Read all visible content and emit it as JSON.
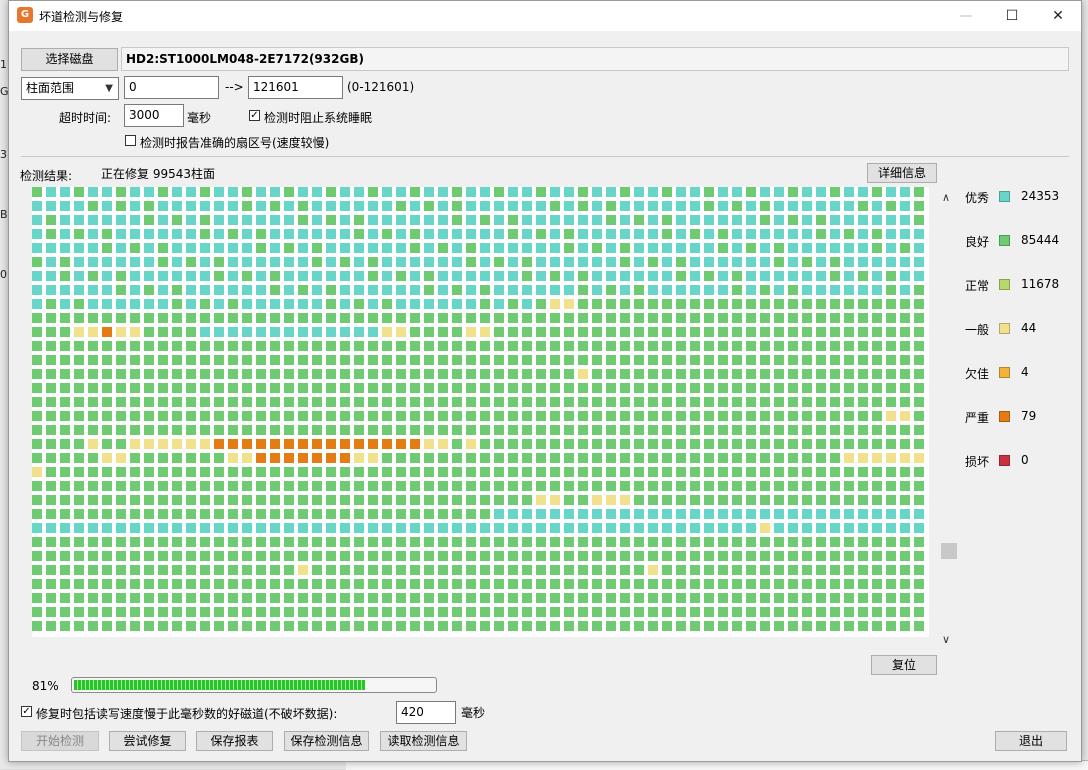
{
  "window": {
    "title": "坏道检测与修复",
    "icon": "app-logo-icon"
  },
  "disk": {
    "select_button": "选择磁盘",
    "name": "HD2:ST1000LM048-2E7172(932GB)"
  },
  "range": {
    "mode": "柱面范围",
    "start": "0",
    "arrow": "-->",
    "end": "121601",
    "hint": "(0-121601)"
  },
  "timeout": {
    "label": "超时时间:",
    "value": "3000",
    "unit": "毫秒"
  },
  "options": {
    "prevent_sleep_label": "检测时阻止系统睡眠",
    "prevent_sleep": true,
    "report_sector_label": "检测时报告准确的扇区号(速度较慢)",
    "report_sector": false
  },
  "result": {
    "label": "检测结果:",
    "status": "正在修复 99543柱面",
    "detail_button": "详细信息"
  },
  "legend": [
    {
      "name": "优秀",
      "count": "24353",
      "color": "#67d6c8"
    },
    {
      "name": "良好",
      "count": "85444",
      "color": "#6ecb72"
    },
    {
      "name": "正常",
      "count": "11678",
      "color": "#b7d86a"
    },
    {
      "name": "一般",
      "count": "44",
      "color": "#f1e18c"
    },
    {
      "name": "欠佳",
      "count": "4",
      "color": "#f2b33d"
    },
    {
      "name": "严重",
      "count": "79",
      "color": "#e57b13"
    },
    {
      "name": "损坏",
      "count": "0",
      "color": "#c8323c"
    }
  ],
  "reset_button": "复位",
  "progress": {
    "percent_label": "81%",
    "value": 0.81
  },
  "repair_option": {
    "checked": true,
    "label": "修复时包括读写速度慢于此毫秒数的好磁道(不破坏数据):",
    "value": "420",
    "unit": "毫秒"
  },
  "buttons": {
    "start": "开始检测",
    "try_repair": "尝试修复",
    "save_report": "保存报表",
    "save_info": "保存检测信息",
    "load_info": "读取检测信息",
    "exit": "退出"
  }
}
